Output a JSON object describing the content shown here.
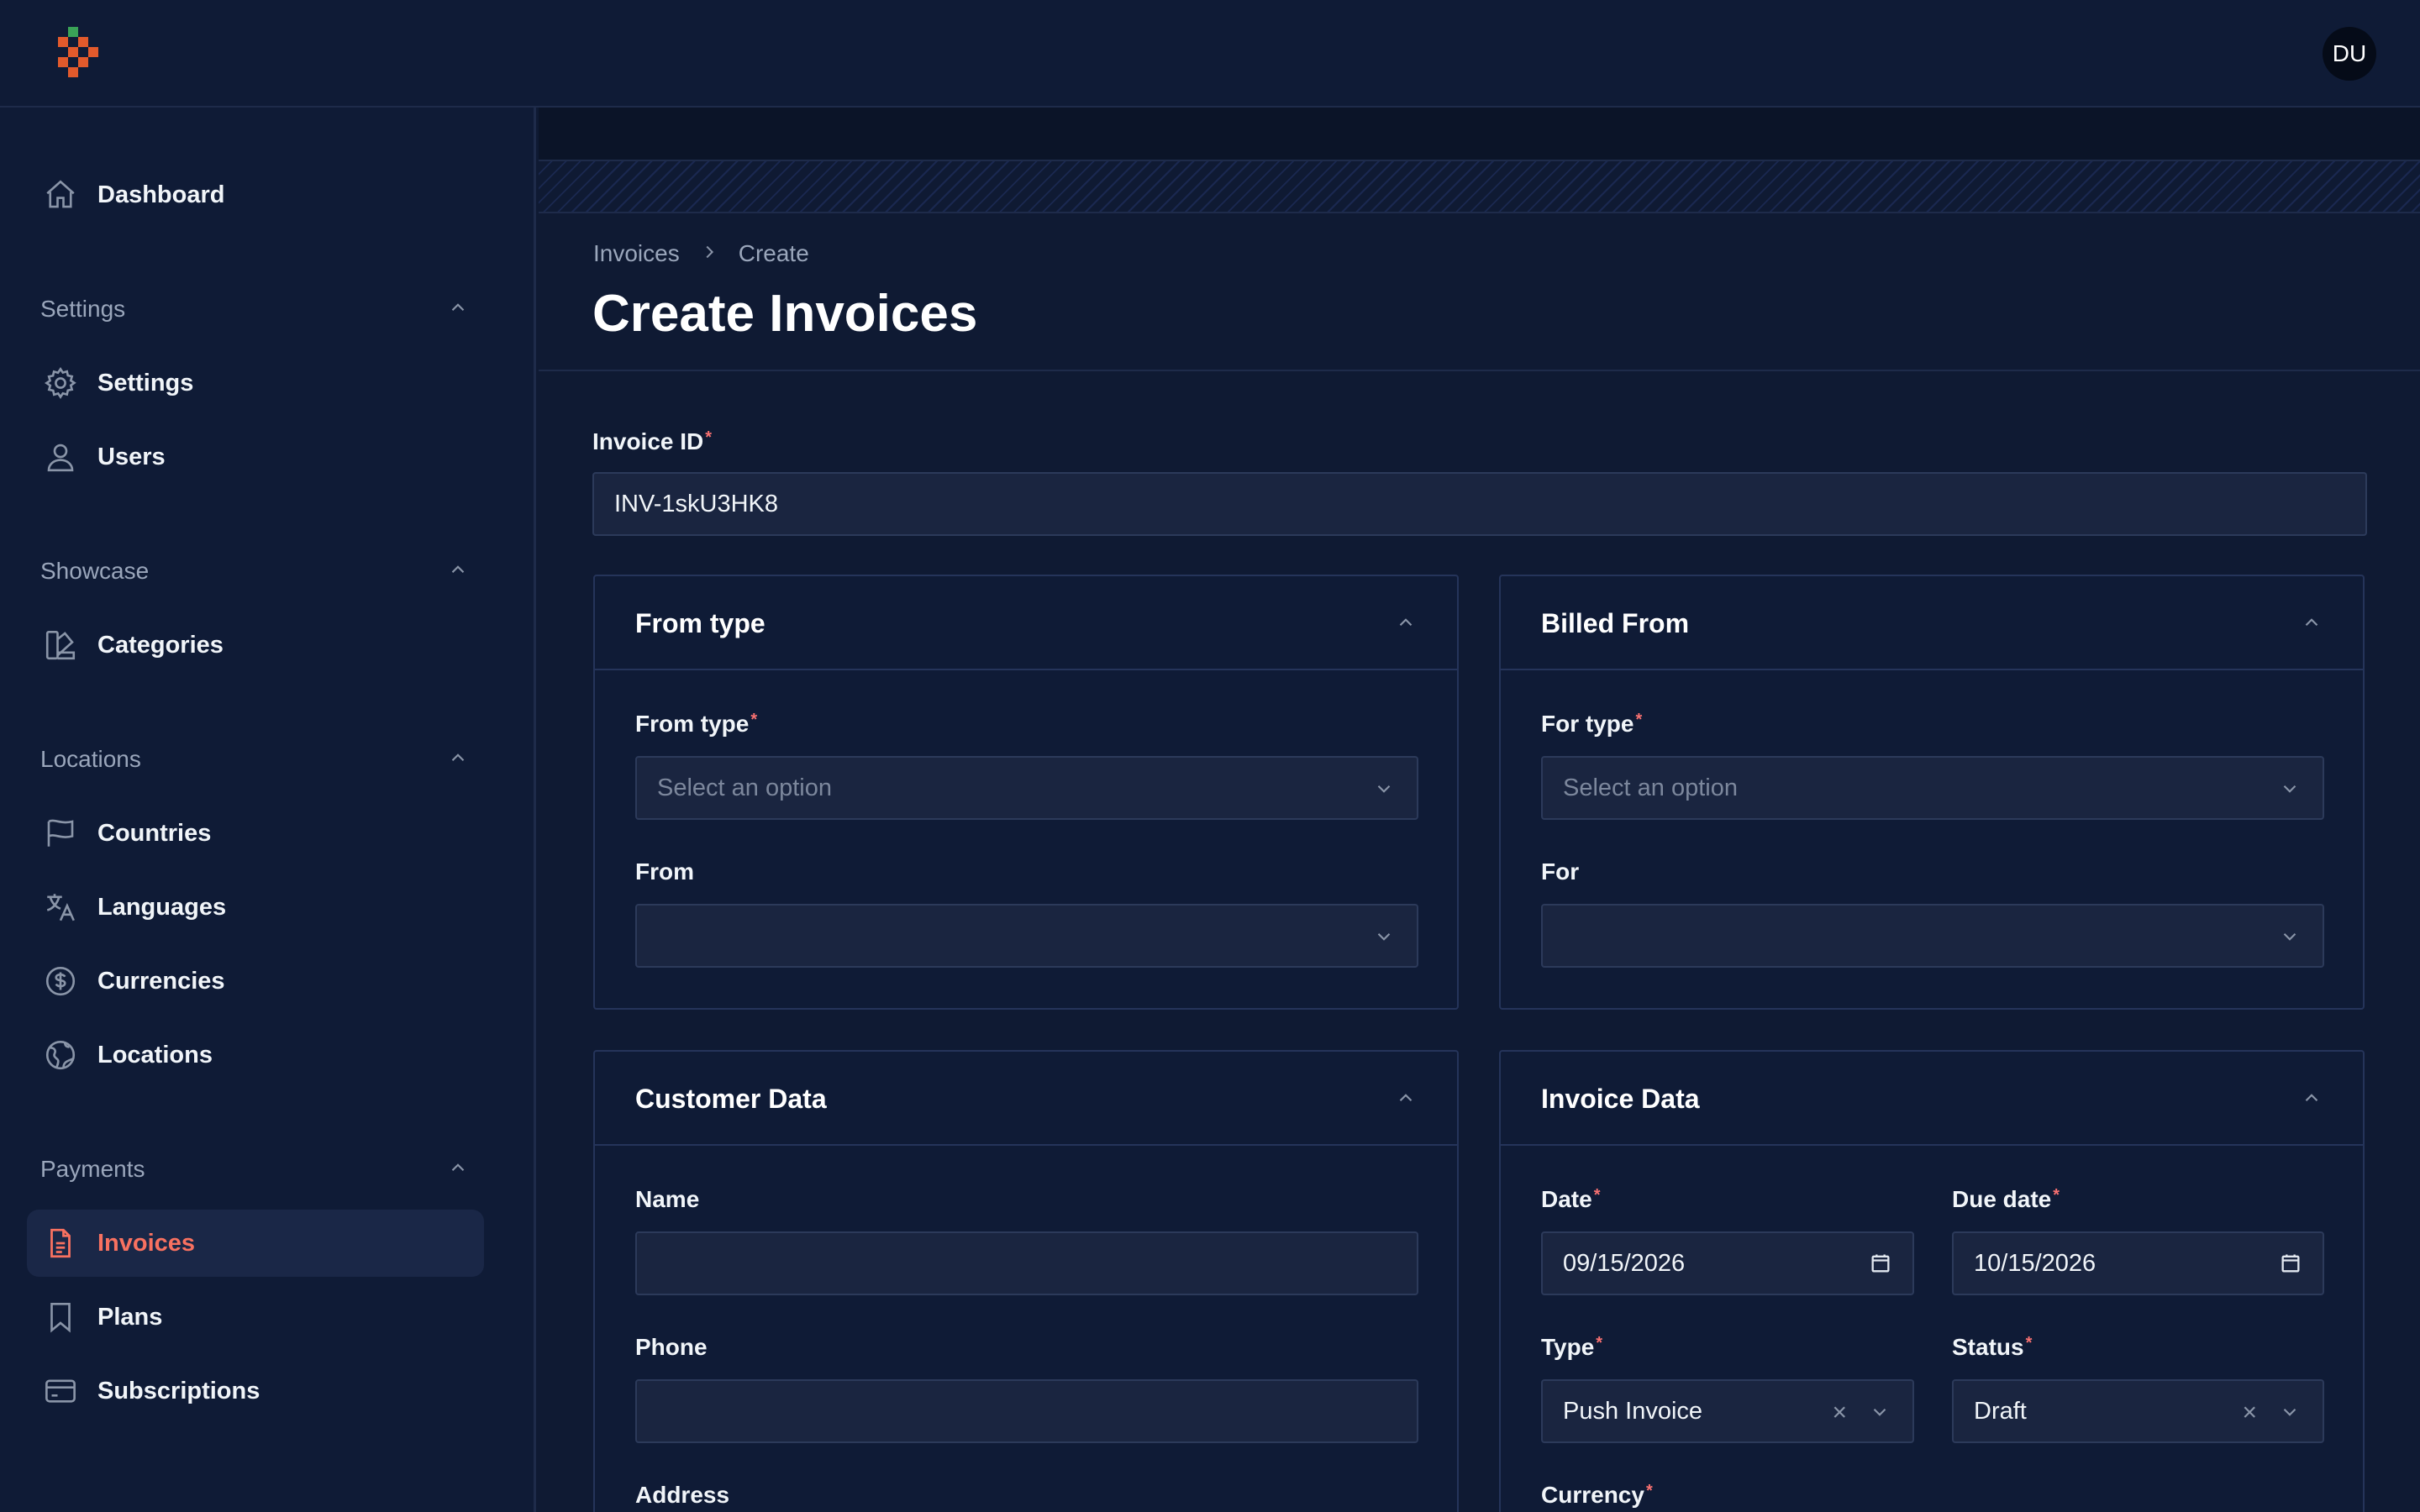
{
  "header": {
    "avatar_initials": "DU"
  },
  "sidebar": {
    "dashboard": "Dashboard",
    "groups": {
      "settings": {
        "label": "Settings",
        "items": [
          "Settings",
          "Users"
        ]
      },
      "showcase": {
        "label": "Showcase",
        "items": [
          "Categories"
        ]
      },
      "locations": {
        "label": "Locations",
        "items": [
          "Countries",
          "Languages",
          "Currencies",
          "Locations"
        ]
      },
      "payments": {
        "label": "Payments",
        "items": [
          "Invoices",
          "Plans",
          "Subscriptions"
        ]
      }
    },
    "active_item": "Invoices"
  },
  "page": {
    "breadcrumb": [
      "Invoices",
      "Create"
    ],
    "title": "Create Invoices"
  },
  "form": {
    "invoice_id": {
      "label": "Invoice ID",
      "value": "INV-1skU3HK8"
    },
    "from_type_card": {
      "title": "From type",
      "from_type": {
        "label": "From type",
        "placeholder": "Select an option"
      },
      "from": {
        "label": "From",
        "value": ""
      }
    },
    "billed_from_card": {
      "title": "Billed From",
      "for_type": {
        "label": "For type",
        "placeholder": "Select an option"
      },
      "for": {
        "label": "For",
        "value": ""
      }
    },
    "customer_card": {
      "title": "Customer Data",
      "name": {
        "label": "Name",
        "value": ""
      },
      "phone": {
        "label": "Phone",
        "value": ""
      },
      "address": {
        "label": "Address"
      }
    },
    "invoice_card": {
      "title": "Invoice Data",
      "date": {
        "label": "Date",
        "value": "09/15/2026"
      },
      "due_date": {
        "label": "Due date",
        "value": "10/15/2026"
      },
      "type": {
        "label": "Type",
        "value": "Push Invoice"
      },
      "status": {
        "label": "Status",
        "value": "Draft"
      },
      "currency": {
        "label": "Currency"
      }
    }
  },
  "colors": {
    "accent": "#f87160",
    "background": "#0f1a33",
    "required_marker": "#f87171"
  }
}
